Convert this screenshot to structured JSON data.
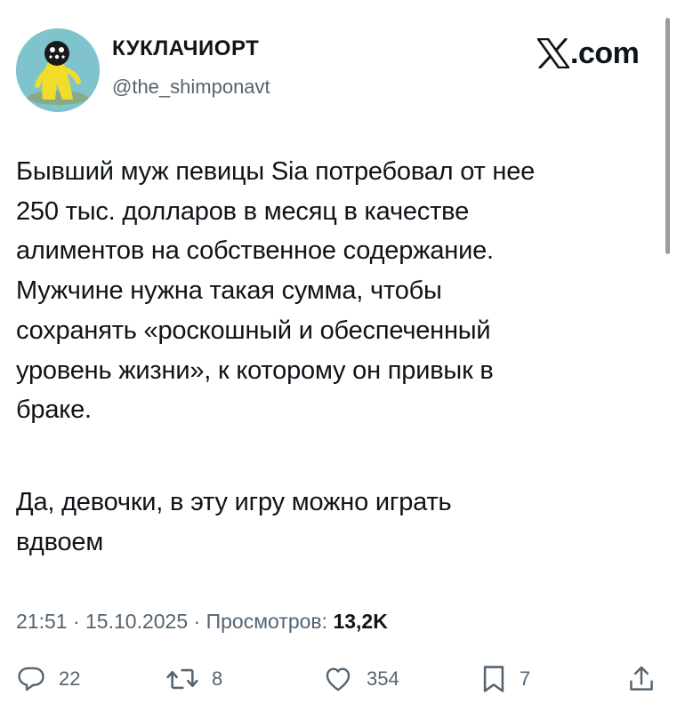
{
  "author": {
    "display_name": "КУКЛАЧИОРТ",
    "handle": "@the_shimponavt",
    "avatar_icon": "avatar-yellow-figure"
  },
  "brand": {
    "domain": ".com",
    "icon": "x-logo-icon"
  },
  "tweet": {
    "lines": [
      "Бывший муж певицы Sia потребовал от нее",
      "250 тыс. долларов в месяц в качестве",
      "алиментов на собственное содержание.",
      "Мужчине нужна такая сумма, чтобы",
      "сохранять «роскошный и обеспеченный",
      "уровень жизни», к которому он привык в",
      "браке."
    ],
    "lines2": [
      "Да, девочки, в эту игру можно играть",
      "вдвоем"
    ]
  },
  "meta": {
    "time": "21:51",
    "sep1": " · ",
    "date": "15.10.2025",
    "sep2": " · ",
    "views_label": "Просмотров: ",
    "views_count": "13,2K"
  },
  "actions": {
    "replies": "22",
    "reposts": "8",
    "likes": "354",
    "bookmarks": "7"
  },
  "colors": {
    "text": "#0f1419",
    "secondary": "#536471",
    "avatar_bg": "#7fc4cc",
    "avatar_figure": "#f2dc2a"
  }
}
